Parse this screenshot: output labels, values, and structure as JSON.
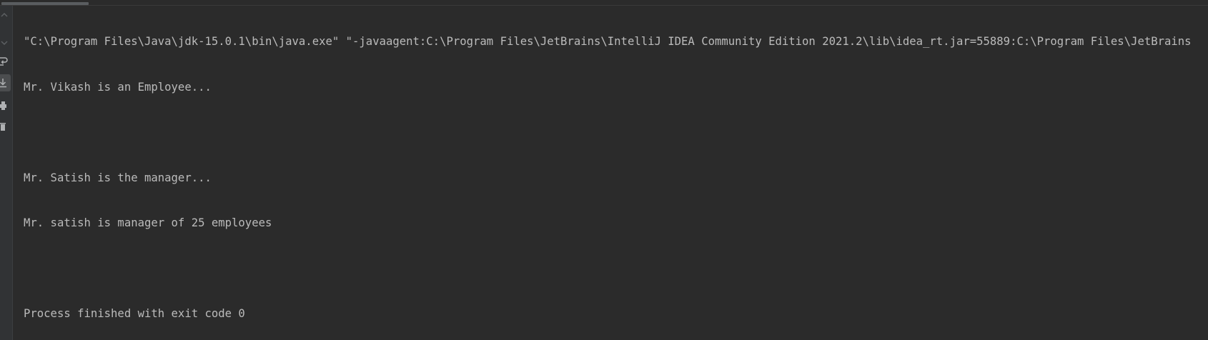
{
  "console": {
    "lines": [
      "\"C:\\Program Files\\Java\\jdk-15.0.1\\bin\\java.exe\" \"-javaagent:C:\\Program Files\\JetBrains\\IntelliJ IDEA Community Edition 2021.2\\lib\\idea_rt.jar=55889:C:\\Program Files\\JetBrains",
      "Mr. Vikash is an Employee...",
      "",
      "Mr. Satish is the manager...",
      "Mr. satish is manager of 25 employees",
      "",
      "Process finished with exit code 0"
    ]
  },
  "toolbar": {
    "icons": [
      "up-arrow-icon",
      "down-arrow-icon",
      "soft-wrap-icon",
      "scroll-to-end-icon",
      "print-icon",
      "clear-all-icon"
    ]
  },
  "colors": {
    "background": "#2b2b2b",
    "gutter": "#313335",
    "text": "#bbbbbb",
    "icon": "#afb1b3",
    "icon_disabled": "#5d6063"
  }
}
